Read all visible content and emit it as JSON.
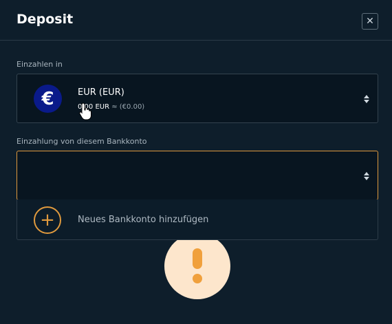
{
  "header": {
    "title": "Deposit",
    "close_label": "✕"
  },
  "currency_field": {
    "label": "Einzahlen in",
    "currency_name": "EUR (EUR)",
    "balance": "0,00 EUR",
    "approx": "≈ (€0.00)",
    "icon": "euro-icon",
    "icon_glyph": "€",
    "icon_color": "#0a1a8a"
  },
  "bank_field": {
    "label": "Einzahlung von diesem Bankkonto",
    "value": ""
  },
  "dropdown": {
    "add_label": "Neues Bankkonto hinzufügen",
    "add_glyph": "+",
    "icon": "plus-circle-icon"
  },
  "colors": {
    "background": "#0e1e2b",
    "accent": "#e09a3e",
    "warning_bg": "#fde6cc"
  },
  "warning": {
    "icon": "exclamation-icon"
  }
}
